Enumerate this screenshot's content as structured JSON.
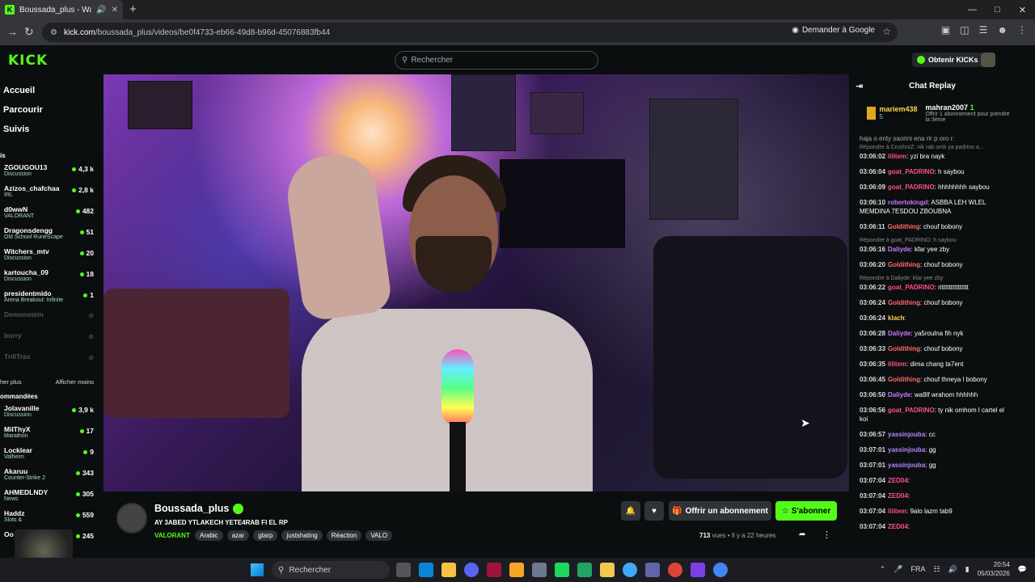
{
  "browser": {
    "tab_title": "Boussada_plus - Watch the",
    "url_host": "kick.com",
    "url_path": "/boussada_plus/videos/be0f4733-eb66-49d8-b96d-45076883fb44",
    "ask_google": "Demander à Google"
  },
  "header": {
    "logo": "KICK",
    "search_placeholder": "Rechercher",
    "kicks_button": "Obtenir KICKs"
  },
  "sidebar": {
    "nav": [
      "Accueil",
      "Parcourir",
      "Suivis"
    ],
    "section1_title": "is",
    "followed": [
      {
        "name": "ZGOUGOU13",
        "cat": "Discussion",
        "viewers": "4,3 k"
      },
      {
        "name": "Azizos_chafchaa",
        "cat": "IRL",
        "viewers": "2,8 k"
      },
      {
        "name": "d0wwN",
        "cat": "VALORANT",
        "viewers": "482"
      },
      {
        "name": "Dragonsdengg",
        "cat": "Old School RuneScape",
        "viewers": "51"
      },
      {
        "name": "Witchers_mtv",
        "cat": "Discussion",
        "viewers": "20"
      },
      {
        "name": "kartoucha_09",
        "cat": "Discussion",
        "viewers": "18"
      },
      {
        "name": "presidentmido",
        "cat": "Arena Breakout: Infinite",
        "viewers": "1"
      }
    ],
    "offline": [
      "Demonstein",
      "borry",
      "TrillTrax"
    ],
    "show_more": "her plus",
    "show_less": "Afficher moins",
    "section2_title": "ommandées",
    "recommended": [
      {
        "name": "Jolavanille",
        "cat": "Discussion",
        "viewers": "3,9 k"
      },
      {
        "name": "MiIThyX",
        "cat": "Marathon",
        "viewers": "17"
      },
      {
        "name": "Locklear",
        "cat": "Valheim",
        "viewers": "9"
      },
      {
        "name": "Akaruu",
        "cat": "Counter-Strike 2",
        "viewers": "343"
      },
      {
        "name": "AHMEDLNDY",
        "cat": "News",
        "viewers": "305"
      },
      {
        "name": "Haddz",
        "cat": "Slots &",
        "viewers": "559"
      },
      {
        "name": "Oo",
        "cat": "",
        "viewers": "245"
      }
    ]
  },
  "stream": {
    "channel": "Boussada_plus",
    "title": "AY 3ABED YTLAKECH YETE4RAB FI EL RP",
    "category": "VALORANT",
    "tags": [
      "Arabic",
      "azar",
      "gtarp",
      "justshating",
      "Réaction",
      "VALO"
    ],
    "gift_label": "Offrir un abonnement",
    "subscribe_label": "S'abonner",
    "views": "713",
    "views_label": " vues",
    "ago": "Il y a 22 heures"
  },
  "chat": {
    "title": "Chat Replay",
    "pinned_user": "mariem438",
    "pinned_count": "5",
    "pinned_gifter": "mahran2007",
    "pinned_gifter_count": "1",
    "pinned_text": "Offrir 1 abonnement pour prendre la 3ème",
    "top_partial": "haja o enty saorini ena rir p oro r:",
    "messages": [
      {
        "reply": "Répondre à CrushrxZ: nik rab omk ya padrino a...",
        "time": "03:06:02",
        "user": "lilitem",
        "color": "#ff4f8b",
        "text": "yzi bra nayk"
      },
      {
        "time": "03:06:04",
        "user": "goat_PADRINO",
        "color": "#ff4f8b",
        "text": "h saybou"
      },
      {
        "time": "03:06:09",
        "user": "goat_PADRINO",
        "color": "#ff4f8b",
        "text": "hhhhhhhh saybou"
      },
      {
        "time": "03:06:10",
        "user": "robertokingd",
        "color": "#c47bff",
        "text": "ASBBA LEH WLEL MEMDINA 7ESDOU ZBOUBNA"
      },
      {
        "time": "03:06:11",
        "user": "Goldithing",
        "color": "#ff6b6b",
        "text": "chouf bobony"
      },
      {
        "reply": "Répondre à goat_PADRINO: h saybou",
        "time": "03:06:16",
        "user": "Daliyde",
        "color": "#c47bff",
        "text": "kfar yee zby"
      },
      {
        "time": "03:06:20",
        "user": "Goldithing",
        "color": "#ff6b6b",
        "text": "chouf bobony"
      },
      {
        "reply": "Répondre à Daliyde: kfar yee zby",
        "time": "03:06:22",
        "user": "goat_PADRINO",
        "color": "#ff4f8b",
        "text": "rittttttttttttttt"
      },
      {
        "time": "03:06:24",
        "user": "Goldithing",
        "color": "#ff6b6b",
        "text": "chouf bobony"
      },
      {
        "time": "03:06:24",
        "user": "klach",
        "color": "#ffd54a",
        "text": ""
      },
      {
        "time": "03:06:28",
        "user": "Daliyde",
        "color": "#c47bff",
        "text": "ya5roulna fih nyk"
      },
      {
        "time": "03:06:33",
        "user": "Goldithing",
        "color": "#ff6b6b",
        "text": "chouf bobony"
      },
      {
        "time": "03:06:35",
        "user": "lilitem",
        "color": "#ff4f8b",
        "text": "dima chang ta7ent"
      },
      {
        "time": "03:06:45",
        "user": "Goldithing",
        "color": "#ff6b6b",
        "text": "chouf thneya l bobony"
      },
      {
        "time": "03:06:50",
        "user": "Daliyde",
        "color": "#c47bff",
        "text": "wa9lf wrahom hhhhhh"
      },
      {
        "time": "03:06:56",
        "user": "goat_PADRINO",
        "color": "#ff4f8b",
        "text": "ty nik omhom l cartel el koi"
      },
      {
        "time": "03:06:57",
        "user": "yassinjouba",
        "color": "#b388ff",
        "text": "cc"
      },
      {
        "time": "03:07:01",
        "user": "yassinjouba",
        "color": "#b388ff",
        "text": "gg"
      },
      {
        "time": "03:07:01",
        "user": "yassinjouba",
        "color": "#b388ff",
        "text": "gg"
      },
      {
        "time": "03:07:04",
        "user": "ZED04",
        "color": "#ff4f8b",
        "text": ""
      },
      {
        "time": "03:07:04",
        "user": "ZED04",
        "color": "#ff4f8b",
        "text": ""
      },
      {
        "time": "03:07:04",
        "user": "lilitem",
        "color": "#ff4f8b",
        "text": "9alo lazm tab9"
      },
      {
        "time": "03:07:04",
        "user": "ZED04",
        "color": "#ff4f8b",
        "text": ""
      }
    ]
  },
  "taskbar": {
    "search": "Rechercher",
    "lang": "FRA",
    "time": "20:54",
    "date": "05/03/2026"
  },
  "colors": {
    "accent": "#53fc18",
    "bg": "#0b0e0f"
  }
}
